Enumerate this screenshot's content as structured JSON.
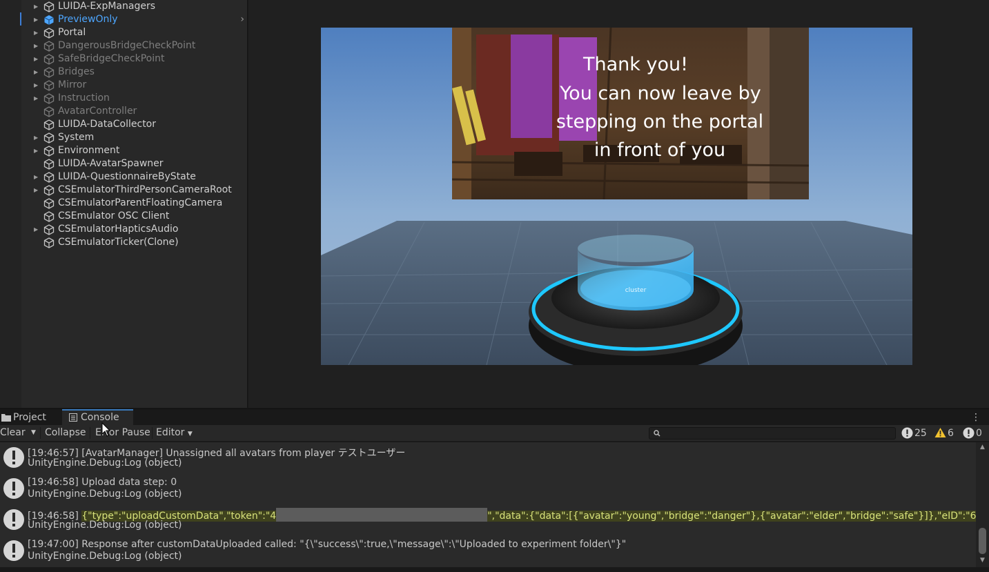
{
  "hierarchy": {
    "items": [
      {
        "label": "LUIDA-ExpManagers",
        "arrow": "▶",
        "state": "active"
      },
      {
        "label": "PreviewOnly",
        "arrow": "▶",
        "state": "selected"
      },
      {
        "label": "Portal",
        "arrow": "▶",
        "state": "active"
      },
      {
        "label": "DangerousBridgeCheckPoint",
        "arrow": "▶",
        "state": "inactive"
      },
      {
        "label": "SafeBridgeCheckPoint",
        "arrow": "▶",
        "state": "inactive"
      },
      {
        "label": "Bridges",
        "arrow": "▶",
        "state": "inactive"
      },
      {
        "label": "Mirror",
        "arrow": "▶",
        "state": "inactive"
      },
      {
        "label": "Instruction",
        "arrow": "▶",
        "state": "inactive"
      },
      {
        "label": "AvatarController",
        "arrow": "",
        "state": "inactive"
      },
      {
        "label": "LUIDA-DataCollector",
        "arrow": "",
        "state": "active"
      },
      {
        "label": "System",
        "arrow": "▶",
        "state": "active"
      },
      {
        "label": "Environment",
        "arrow": "▶",
        "state": "active"
      },
      {
        "label": "LUIDA-AvatarSpawner",
        "arrow": "",
        "state": "active"
      },
      {
        "label": "LUIDA-QuestionnaireByState",
        "arrow": "▶",
        "state": "active"
      },
      {
        "label": "CSEmulatorThirdPersonCameraRoot",
        "arrow": "▶",
        "state": "active"
      },
      {
        "label": "CSEmulatorParentFloatingCamera",
        "arrow": "",
        "state": "active"
      },
      {
        "label": "CSEmulator OSC Client",
        "arrow": "",
        "state": "active"
      },
      {
        "label": "CSEmulatorHapticsAudio",
        "arrow": "▶",
        "state": "active"
      },
      {
        "label": "CSEmulatorTicker(Clone)",
        "arrow": "",
        "state": "active"
      }
    ],
    "selected_chevron": "›"
  },
  "scene": {
    "message_lines": [
      "Thank you!",
      "You can now leave by",
      "stepping on the portal",
      "in front of you"
    ],
    "portal_logo_text": "cluster"
  },
  "tabs": {
    "project_label": "Project",
    "console_label": "Console",
    "menu_glyph": "⋮"
  },
  "toolbar": {
    "clear_label": "Clear",
    "collapse_label": "Collapse",
    "error_pause_label": "Error Pause",
    "editor_label": "Editor",
    "search_value": "",
    "log_count": "25",
    "warning_count": "6",
    "error_count": "0"
  },
  "console": {
    "entries": [
      {
        "line1": "[19:46:57] [AvatarManager] Unassigned all avatars from player テストユーザー",
        "line2": "UnityEngine.Debug:Log (object)"
      },
      {
        "line1": "[19:46:58] Upload data step: 0",
        "line2": "UnityEngine.Debug:Log (object)"
      },
      {
        "line1_prefix": "[19:46:58] ",
        "line1_a": "{\"type\":\"uploadCustomData\",\"token\":\"4",
        "line1_b": "\",\"data\":{\"data\":[{\"avatar\":\"young\",\"bridge\":\"danger\"},{\"avatar\":\"elder\",\"bridge\":\"safe\"}]},\"eID\":\"6",
        "line2": "UnityEngine.Debug:Log (object)"
      },
      {
        "line1": "[19:47:00] Response after customDataUploaded called: \"{\\\"success\\\":true,\\\"message\\\":\\\"Uploaded to experiment folder\\\"}\"",
        "line2": "UnityEngine.Debug:Log (object)"
      }
    ]
  },
  "colors": {
    "selected_text": "#4da6ff",
    "highlight_text": "#d8e27a",
    "portal_ring": "#1ec8ff",
    "warning": "#f2c230"
  }
}
